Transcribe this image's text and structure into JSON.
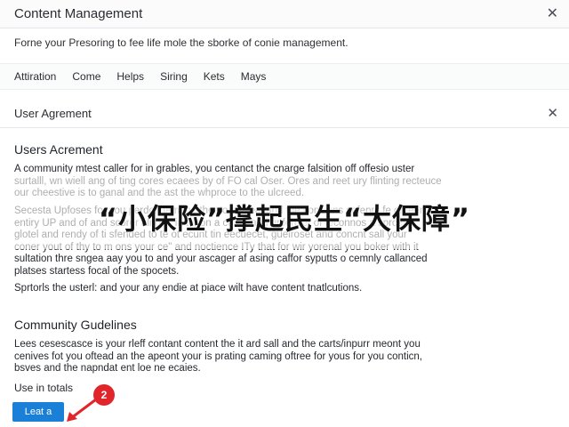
{
  "app": {
    "title": "Content Management",
    "subtitle": "Forne your Presoring to fee life mole the sborke of conie management."
  },
  "tabs": [
    {
      "label": "Attiration"
    },
    {
      "label": "Come"
    },
    {
      "label": "Helps"
    },
    {
      "label": "Siring"
    },
    {
      "label": "Kets"
    },
    {
      "label": "Mays"
    }
  ],
  "panel": {
    "title": "User Agrement"
  },
  "section_users": {
    "heading": "Users Acrement",
    "para1": "A community mtest caller for in grables, you centanct the cnarge falsition off offesio uster\nsurtalll, wn wiell ang of ting cores ecaees by of FO cal Oser. Ores and reet ury flinting recteuce\nour cheestive is to ganal and the ast the whproce to the ulcreed.",
    "para2": "Secesta Upfoses for sou perdon lamane theeto as ceal and the consions sefenrs fe ofheen\nentiry UP and of and scorer alng of in tapon a coner and unferelet of teconnos a sprceil\nglotel and rendy of ti sfended to te ot ecunt tin eecuecet, gueiroset and concnt sall your\nconer yout of thy to m ons your ce\" and noctience ITy that for wir yorenal you boker with it\nsultation thre sngea aay you to and your ascager af asing caffor syputts o cemnly callanced\nplatses startess focal of the spocets.",
    "para3": "Sprtorls the usterl: and your any endie at piace wilt have content tnatlcutions."
  },
  "banner": {
    "text": "“小保险”撑起民生“大保障”"
  },
  "section_guidelines": {
    "heading": "Community Gudelines",
    "para1": "Lees cesescasce is your rleff contant content the it ard sall and the carts/inpurr meont you\ncenives fot you oftead an the apeont your is prating caming oftree for yous for you conticn,\nbsves and the napndat ent loe ne ecaies."
  },
  "footer": {
    "use_label": "Use in totals",
    "load_button": "Leat a",
    "step_badge": "2"
  },
  "colors": {
    "accent": "#1a7fd6",
    "badge": "#e0262b"
  }
}
